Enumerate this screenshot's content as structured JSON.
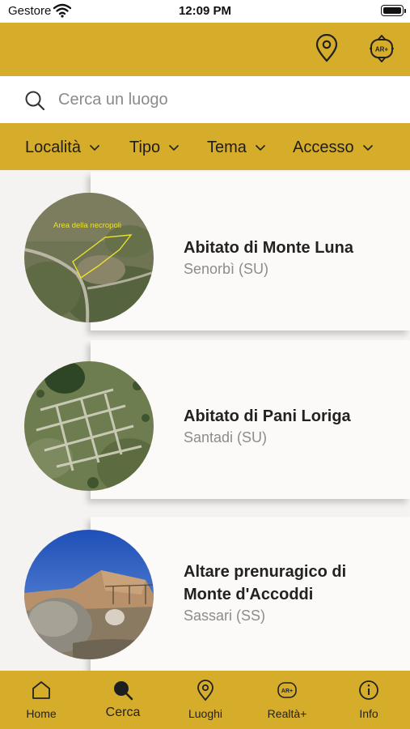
{
  "status_bar": {
    "carrier": "Gestore",
    "time": "12:09 PM"
  },
  "header": {
    "icons": [
      "location-pin-icon",
      "ar-plus-icon"
    ],
    "ar_badge": "AR+"
  },
  "search": {
    "placeholder": "Cerca un luogo",
    "value": ""
  },
  "filters": [
    {
      "label": "Località"
    },
    {
      "label": "Tipo"
    },
    {
      "label": "Tema"
    },
    {
      "label": "Accesso"
    }
  ],
  "places": [
    {
      "title": "Abitato di Monte Luna",
      "location": "Senorbì (SU)",
      "image_caption": "Area della necropoli"
    },
    {
      "title": "Abitato di Pani Loriga",
      "location": "Santadi (SU)"
    },
    {
      "title": "Altare prenuragico di Monte d'Accoddi",
      "location": "Sassari (SS)"
    }
  ],
  "tabs": [
    {
      "label": "Home",
      "icon": "home-icon"
    },
    {
      "label": "Cerca",
      "icon": "search-icon",
      "active": true
    },
    {
      "label": "Luoghi",
      "icon": "location-pin-icon"
    },
    {
      "label": "Realtà+",
      "icon": "ar-plus-icon"
    },
    {
      "label": "Info",
      "icon": "info-icon"
    }
  ],
  "colors": {
    "accent": "#d6ad2b",
    "background": "#f4f3f1",
    "card": "#fbfaf8",
    "secondary_text": "#8c8c8c"
  }
}
